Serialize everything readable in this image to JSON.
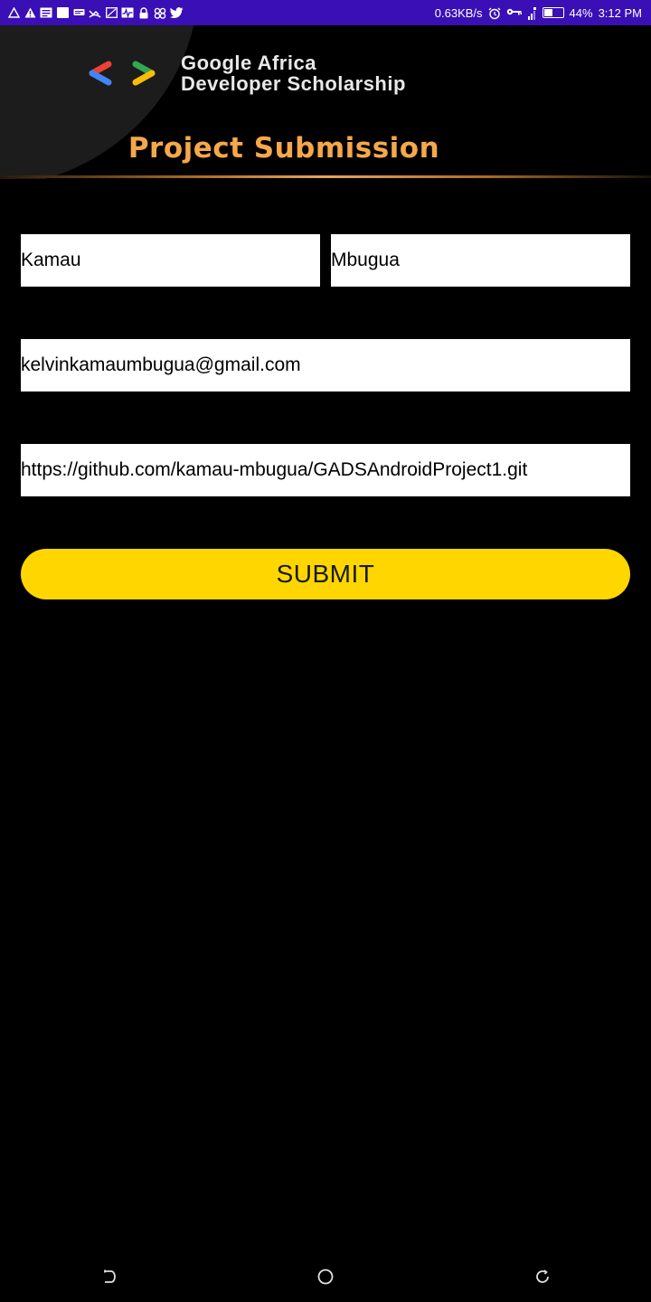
{
  "status_bar": {
    "network_speed": "0.63KB/s",
    "battery_percent": "44%",
    "battery_level": 0.44,
    "time": "3:12 PM",
    "left_icons": [
      "warning-outline-icon",
      "warning-icon",
      "news-icon",
      "square-icon",
      "message-icon",
      "missed-call-icon",
      "screenshot-icon",
      "activity-icon",
      "lock-icon",
      "bluetooth-like-icon",
      "twitter-icon"
    ],
    "right_icons": [
      "alarm-icon",
      "key-icon",
      "signal-icon",
      "battery-icon"
    ]
  },
  "header": {
    "brand_line1": "Google Africa",
    "brand_line2": "Developer Scholarship",
    "title": "Project Submission",
    "logo_colors": {
      "left_chevron_top": "#ea4335",
      "left_chevron_bottom": "#4285f4",
      "right_chevron_top": "#34a853",
      "right_chevron_bottom": "#fbbc05"
    }
  },
  "form": {
    "first_name": "Kamau",
    "last_name": "Mbugua",
    "email": "kelvinkamaumbugua@gmail.com",
    "github_link": "https://github.com/kamau-mbugua/GADSAndroidProject1.git",
    "submit_label": "SUBMIT"
  },
  "colors": {
    "status_bar": "#3a0fb5",
    "title": "#f5a84a",
    "submit": "#ffd600",
    "background": "#000000"
  },
  "nav": {
    "items": [
      "back-icon",
      "home-icon",
      "recents-icon"
    ]
  }
}
